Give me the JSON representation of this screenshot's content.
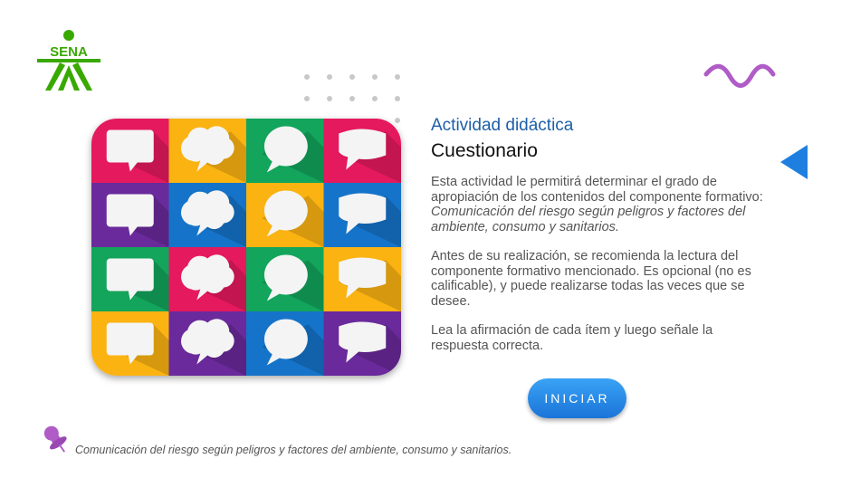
{
  "logo": {
    "text": "SENA",
    "color": "#39a900"
  },
  "activity": {
    "subtitle": "Actividad didáctica",
    "title": "Cuestionario",
    "paragraph1_intro": "Esta actividad le permitirá determinar el grado de apropiación de los contenidos del componente formativo: ",
    "paragraph1_topic": "Comunicación del riesgo según peligros y factores del ambiente, consumo y sanitarios.",
    "paragraph2": "Antes de su realización, se recomienda la lectura del componente formativo mencionado. Es opcional (no es calificable), y puede realizarse todas las veces que se desee.",
    "paragraph3": "Lea la afirmación de cada ítem y luego señale la respuesta correcta."
  },
  "start_button": {
    "label": "INICIAR",
    "color": "#1f7fe0"
  },
  "footer": {
    "text": "Comunicación del riesgo según peligros y factores del ambiente, consumo y sanitarios."
  },
  "colors": {
    "accent_blue": "#1f7fe0",
    "wave_purple": "#b05cc7",
    "tiles": [
      "#e5195d",
      "#fbb312",
      "#12a55b",
      "#e5195d",
      "#6a2a9b",
      "#1574c9",
      "#fbb312",
      "#1574c9",
      "#12a55b",
      "#e5195d",
      "#12a55b",
      "#fbb312",
      "#fbb312",
      "#6a2a9b",
      "#1574c9",
      "#6a2a9b"
    ]
  },
  "icons": {
    "logo": "sena-logo-icon",
    "decoration": "dot-grid-icon",
    "wave": "wave-icon",
    "back": "triangle-left-icon",
    "pin": "pushpin-icon",
    "image": "speech-bubbles-image"
  }
}
